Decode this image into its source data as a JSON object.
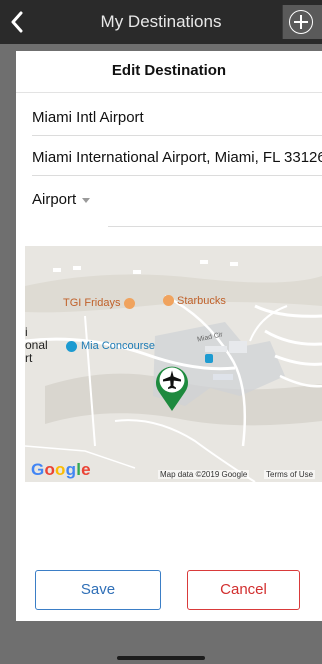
{
  "nav": {
    "title": "My Destinations",
    "back_icon": "chevron-left-icon",
    "add_icon": "plus-circle-icon"
  },
  "dialog": {
    "title": "Edit Destination",
    "name_value": "Miami Intl Airport",
    "address_value": "Miami International Airport, Miami, FL 33126",
    "type_selected": "Airport"
  },
  "map": {
    "labels": {
      "tgi": "TGI Fridays",
      "starbucks": "Starbucks",
      "concourse": "Mia Concourse",
      "street": "Miad Cir",
      "edge_i": "i",
      "edge_onal": "onal",
      "edge_rt": "rt"
    },
    "google_letters": [
      "G",
      "o",
      "o",
      "g",
      "l",
      "e"
    ],
    "map_data": "Map data ©2019 Google",
    "terms": "Terms of Use",
    "pin_icon": "airplane-icon",
    "pin_color": "#1e8a3e"
  },
  "buttons": {
    "save": "Save",
    "cancel": "Cancel"
  },
  "colors": {
    "save": "#2f6fb7",
    "cancel": "#d22f2f"
  }
}
